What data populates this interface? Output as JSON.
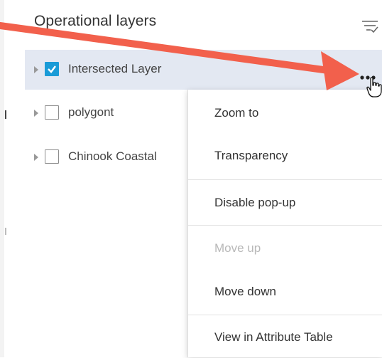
{
  "panel": {
    "title": "Operational layers",
    "filter_icon": "filter-list-icon"
  },
  "layers": [
    {
      "label": "Intersected Layer",
      "checked": true,
      "selected": true
    },
    {
      "label": "polygont",
      "checked": false,
      "selected": false
    },
    {
      "label": "Chinook Coastal",
      "checked": false,
      "selected": false
    }
  ],
  "row_actions": {
    "more_icon": "more-options-icon"
  },
  "context_menu": {
    "items": [
      {
        "label": "Zoom to",
        "enabled": true
      },
      {
        "label": "Transparency",
        "enabled": true
      },
      {
        "label": "Disable pop-up",
        "enabled": true
      },
      {
        "label": "Move up",
        "enabled": false
      },
      {
        "label": "Move down",
        "enabled": true
      },
      {
        "label": "View in Attribute Table",
        "enabled": true
      }
    ]
  },
  "colors": {
    "checkbox_checked": "#1a9bd7",
    "selected_row": "#e3e8f2",
    "annotation_arrow": "#f2604c"
  }
}
